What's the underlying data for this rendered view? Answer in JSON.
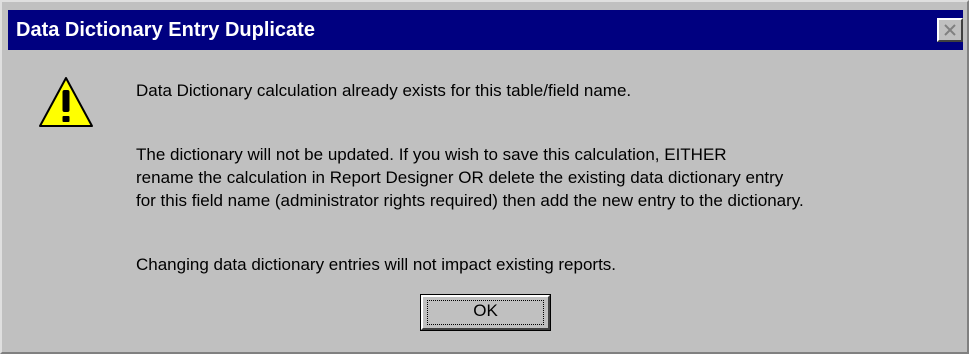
{
  "dialog": {
    "title": "Data Dictionary Entry Duplicate",
    "icon": "warning-icon",
    "messages": {
      "line1": "Data Dictionary calculation already exists for this table/field name.",
      "para2_line1": "The dictionary will not be updated. If you wish to save this calculation, EITHER",
      "para2_line2": "rename the calculation in Report Designer OR delete the existing data dictionary entry",
      "para2_line3": "for this field name (administrator rights required) then add the new entry to the dictionary.",
      "line3": "Changing data dictionary entries will not impact existing reports."
    },
    "ok_label": "OK"
  },
  "colors": {
    "titlebar": "#000080",
    "face": "#c0c0c0",
    "warning_fill": "#ffff00"
  }
}
